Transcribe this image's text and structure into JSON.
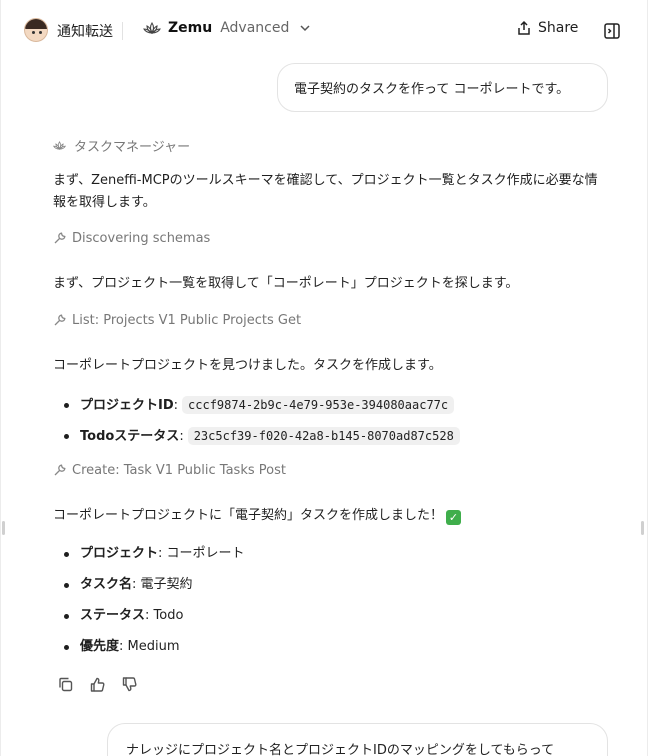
{
  "header": {
    "brand": "通知転送",
    "model_name": "Zemu",
    "model_tier": "Advanced",
    "share_label": "Share"
  },
  "messages": {
    "user1": "電子契約のタスクを作って コーポレートです。",
    "agent_name": "タスクマネージャー",
    "p1": "まず、Zeneffi-MCPのツールスキーマを確認して、プロジェクト一覧とタスク作成に必要な情報を取得します。",
    "tool1": "Discovering schemas",
    "p2": "まず、プロジェクト一覧を取得して「コーポレート」プロジェクトを探します。",
    "tool2": "List: Projects V1 Public Projects Get",
    "p3": "コーポレートプロジェクトを見つけました。タスクを作成します。",
    "ids": [
      {
        "label": "プロジェクトID",
        "value": "cccf9874-2b9c-4e79-953e-394080aac77c"
      },
      {
        "label": "Todoステータス",
        "value": "23c5cf39-f020-42a8-b145-8070ad87c528"
      }
    ],
    "tool3": "Create: Task V1 Public Tasks Post",
    "p4": "コーポレートプロジェクトに「電子契約」タスクを作成しました！",
    "p4_emoji": "✓",
    "details": [
      {
        "label": "プロジェクト",
        "value": "コーポレート"
      },
      {
        "label": "タスク名",
        "value": "電子契約"
      },
      {
        "label": "ステータス",
        "value": "Todo"
      },
      {
        "label": "優先度",
        "value": "Medium"
      }
    ],
    "user2": "ナレッジにプロジェクト名とプロジェクトIDのマッピングをしてもらって"
  },
  "colors": {
    "check_green": "#3fae4b",
    "muted": "#777777",
    "border": "#e3e3e3"
  },
  "icons": {
    "lotus": "lotus-icon",
    "chevron": "chevron-down-icon",
    "share": "share-icon",
    "panel": "sidebar-toggle-icon",
    "tool": "wrench-icon",
    "copy": "copy-icon",
    "up": "thumbs-up-icon",
    "down": "thumbs-down-icon"
  }
}
